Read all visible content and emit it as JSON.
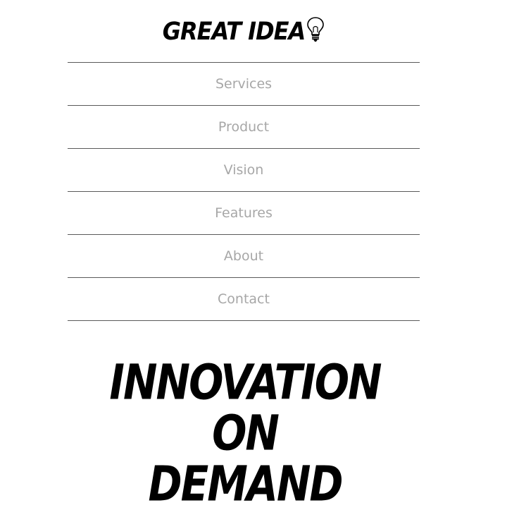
{
  "header": {
    "logo_text": "GREAT IDEA",
    "logo_icon": "lightbulb-icon"
  },
  "nav": {
    "items": [
      {
        "label": "Services"
      },
      {
        "label": "Product"
      },
      {
        "label": "Vision"
      },
      {
        "label": "Features"
      },
      {
        "label": "About"
      },
      {
        "label": "Contact"
      }
    ]
  },
  "hero": {
    "lines": [
      "INNOVATION",
      "ON",
      "DEMAND"
    ]
  },
  "colors": {
    "text": "#000000",
    "nav_text": "#a7a7a7",
    "divider": "#5a5a5a",
    "background": "#ffffff"
  }
}
